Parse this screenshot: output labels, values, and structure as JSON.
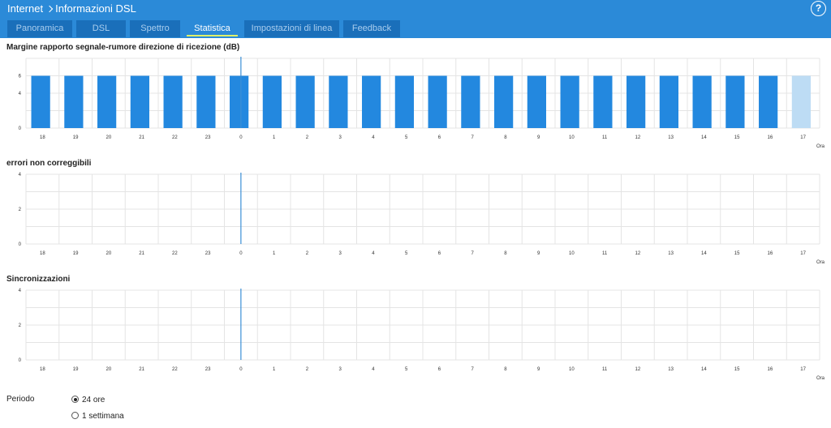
{
  "header": {
    "breadcrumb": [
      "Internet",
      "Informazioni DSL"
    ],
    "help_glyph": "?"
  },
  "tabs": [
    {
      "label": "Panoramica",
      "active": false
    },
    {
      "label": "DSL",
      "active": false
    },
    {
      "label": "Spettro",
      "active": false
    },
    {
      "label": "Statistica",
      "active": true
    },
    {
      "label": "Impostazioni di linea",
      "active": false
    },
    {
      "label": "Feedback",
      "active": false
    }
  ],
  "colors": {
    "header": "#2b8ad8",
    "tab_inactive": "#1a6fba",
    "bar": "#2388df",
    "bar_current": "#bddcf4",
    "grid": "#e4e4e4",
    "marker": "#3b8fd6",
    "active_underline": "#dff068"
  },
  "hours": [
    "18",
    "19",
    "20",
    "21",
    "22",
    "23",
    "0",
    "1",
    "2",
    "3",
    "4",
    "5",
    "6",
    "7",
    "8",
    "9",
    "10",
    "11",
    "12",
    "13",
    "14",
    "15",
    "16",
    "17"
  ],
  "x_unit": "Ora",
  "chart_data": [
    {
      "type": "bar",
      "title": "Margine rapporto segnale-rumore direzione di ricezione (dB)",
      "categories": [
        "18",
        "19",
        "20",
        "21",
        "22",
        "23",
        "0",
        "1",
        "2",
        "3",
        "4",
        "5",
        "6",
        "7",
        "8",
        "9",
        "10",
        "11",
        "12",
        "13",
        "14",
        "15",
        "16",
        "17"
      ],
      "values": [
        6,
        6,
        6,
        6,
        6,
        6,
        6,
        6,
        6,
        6,
        6,
        6,
        6,
        6,
        6,
        6,
        6,
        6,
        6,
        6,
        6,
        6,
        6,
        6
      ],
      "current_index": 23,
      "marker_category": "0",
      "yticks": [
        "0",
        "4",
        "6"
      ],
      "ylim": [
        0,
        8
      ],
      "xlabel": "Ora",
      "grid": true
    },
    {
      "type": "bar",
      "title": "errori non correggibili",
      "categories": [
        "18",
        "19",
        "20",
        "21",
        "22",
        "23",
        "0",
        "1",
        "2",
        "3",
        "4",
        "5",
        "6",
        "7",
        "8",
        "9",
        "10",
        "11",
        "12",
        "13",
        "14",
        "15",
        "16",
        "17"
      ],
      "values": [
        0,
        0,
        0,
        0,
        0,
        0,
        0,
        0,
        0,
        0,
        0,
        0,
        0,
        0,
        0,
        0,
        0,
        0,
        0,
        0,
        0,
        0,
        0,
        0
      ],
      "marker_category": "0",
      "yticks": [
        "0",
        "2",
        "4"
      ],
      "ylim": [
        0,
        4
      ],
      "xlabel": "Ora",
      "grid": true
    },
    {
      "type": "bar",
      "title": "Sincronizzazioni",
      "categories": [
        "18",
        "19",
        "20",
        "21",
        "22",
        "23",
        "0",
        "1",
        "2",
        "3",
        "4",
        "5",
        "6",
        "7",
        "8",
        "9",
        "10",
        "11",
        "12",
        "13",
        "14",
        "15",
        "16",
        "17"
      ],
      "values": [
        0,
        0,
        0,
        0,
        0,
        0,
        0,
        0,
        0,
        0,
        0,
        0,
        0,
        0,
        0,
        0,
        0,
        0,
        0,
        0,
        0,
        0,
        0,
        0
      ],
      "marker_category": "0",
      "yticks": [
        "0",
        "2",
        "4"
      ],
      "ylim": [
        0,
        4
      ],
      "xlabel": "Ora",
      "grid": true
    }
  ],
  "period": {
    "label": "Periodo",
    "options": [
      {
        "label": "24 ore",
        "selected": true
      },
      {
        "label": "1 settimana",
        "selected": false
      }
    ]
  }
}
